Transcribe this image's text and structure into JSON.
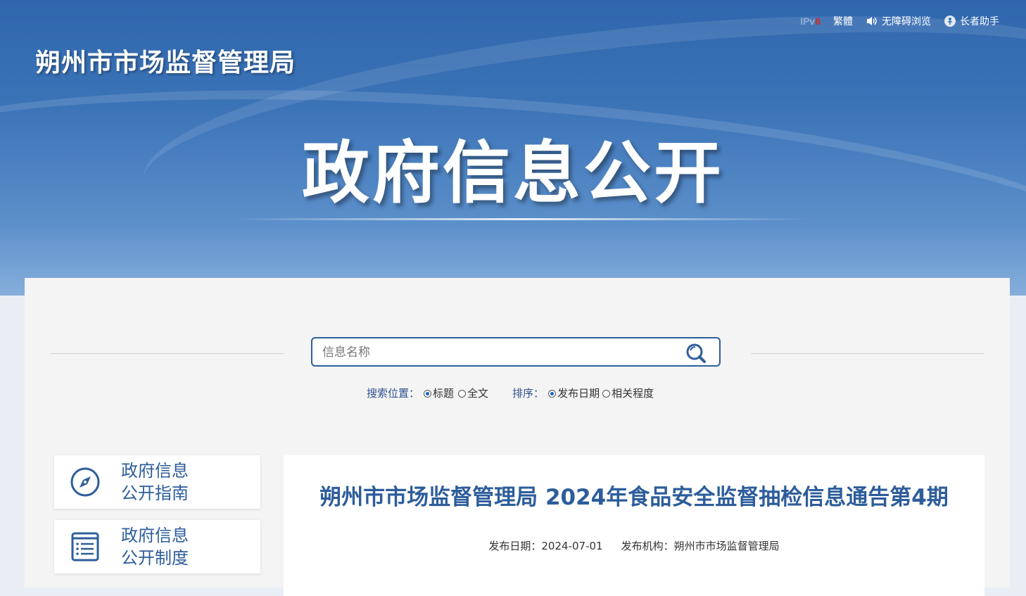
{
  "top_links": {
    "ipv6_prefix": "IPv",
    "ipv6_suffix": "6",
    "traditional": "繁體",
    "accessible": "无障碍浏览",
    "elder": "长者助手"
  },
  "header": {
    "org_name": "朔州市市场监督管理局",
    "hero_title": "政府信息公开"
  },
  "search": {
    "placeholder": "信息名称",
    "scope_label": "搜索位置：",
    "scope_options": [
      "标题",
      "全文"
    ],
    "scope_selected": "标题",
    "sort_label": "排序：",
    "sort_options": [
      "发布日期",
      "相关程度"
    ],
    "sort_selected": "发布日期"
  },
  "sidebar": {
    "items": [
      {
        "line1": "政府信息",
        "line2": "公开指南",
        "icon": "compass-icon"
      },
      {
        "line1": "政府信息",
        "line2": "公开制度",
        "icon": "list-document-icon"
      }
    ]
  },
  "article": {
    "title": "朔州市市场监督管理局 2024年食品安全监督抽检信息通告第4期",
    "date_label": "发布日期：",
    "date": "2024-07-01",
    "org_label": "发布机构：",
    "org": "朔州市市场监督管理局"
  },
  "colors": {
    "brand_blue": "#2d5d9b",
    "banner_blue": "#3b73b7",
    "ipv6_red": "#d42a2a"
  }
}
